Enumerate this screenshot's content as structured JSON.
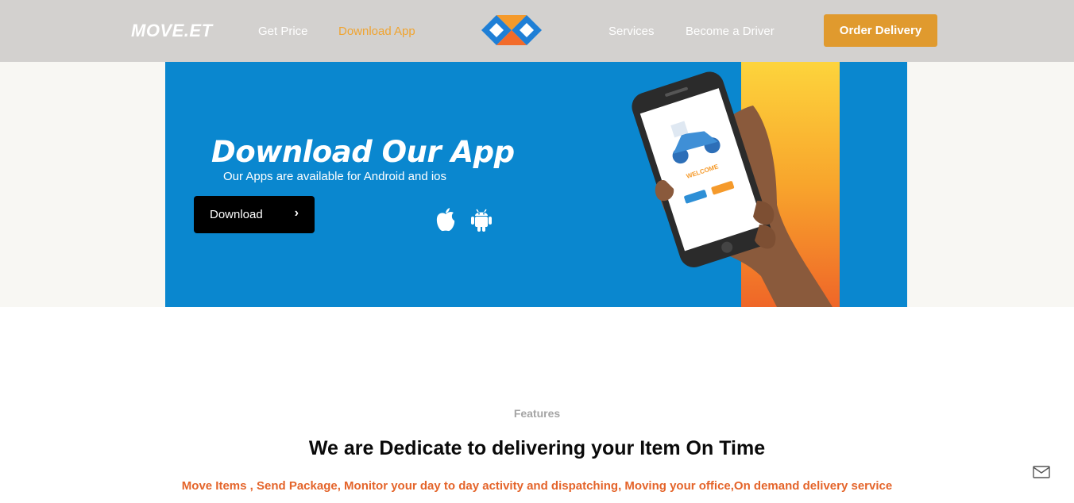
{
  "header": {
    "logo_text": "MOVE.ET",
    "nav": [
      {
        "label": "Get Price"
      },
      {
        "label": "Download App",
        "active": true
      },
      {
        "label": "Services"
      },
      {
        "label": "Become a Driver"
      }
    ],
    "cta_label": "Order Delivery",
    "colors": {
      "header_bg": "#d3d1cf",
      "accent": "#f0a431",
      "cta_bg": "#e09a2e"
    }
  },
  "banner": {
    "title": "Download Our App",
    "subtitle": "Our Apps are available for Android and ios",
    "download_label": "Download",
    "download_chevron": "›",
    "icons": [
      "apple-icon",
      "android-icon"
    ],
    "phone_screen": {
      "welcome": "WELCOME"
    },
    "colors": {
      "bg": "#0a87cf",
      "stripe_top": "#fdd43c",
      "stripe_bottom": "#ef6628"
    }
  },
  "features": {
    "label": "Features",
    "title": "We are Dedicate to delivering your Item On Time",
    "subtitle": "Move Items , Send Package, Monitor your day to day activity and dispatching, Moving your office,On demand delivery service",
    "colors": {
      "subtitle": "#e4642a"
    }
  },
  "floating": {
    "icon": "mail-icon"
  }
}
